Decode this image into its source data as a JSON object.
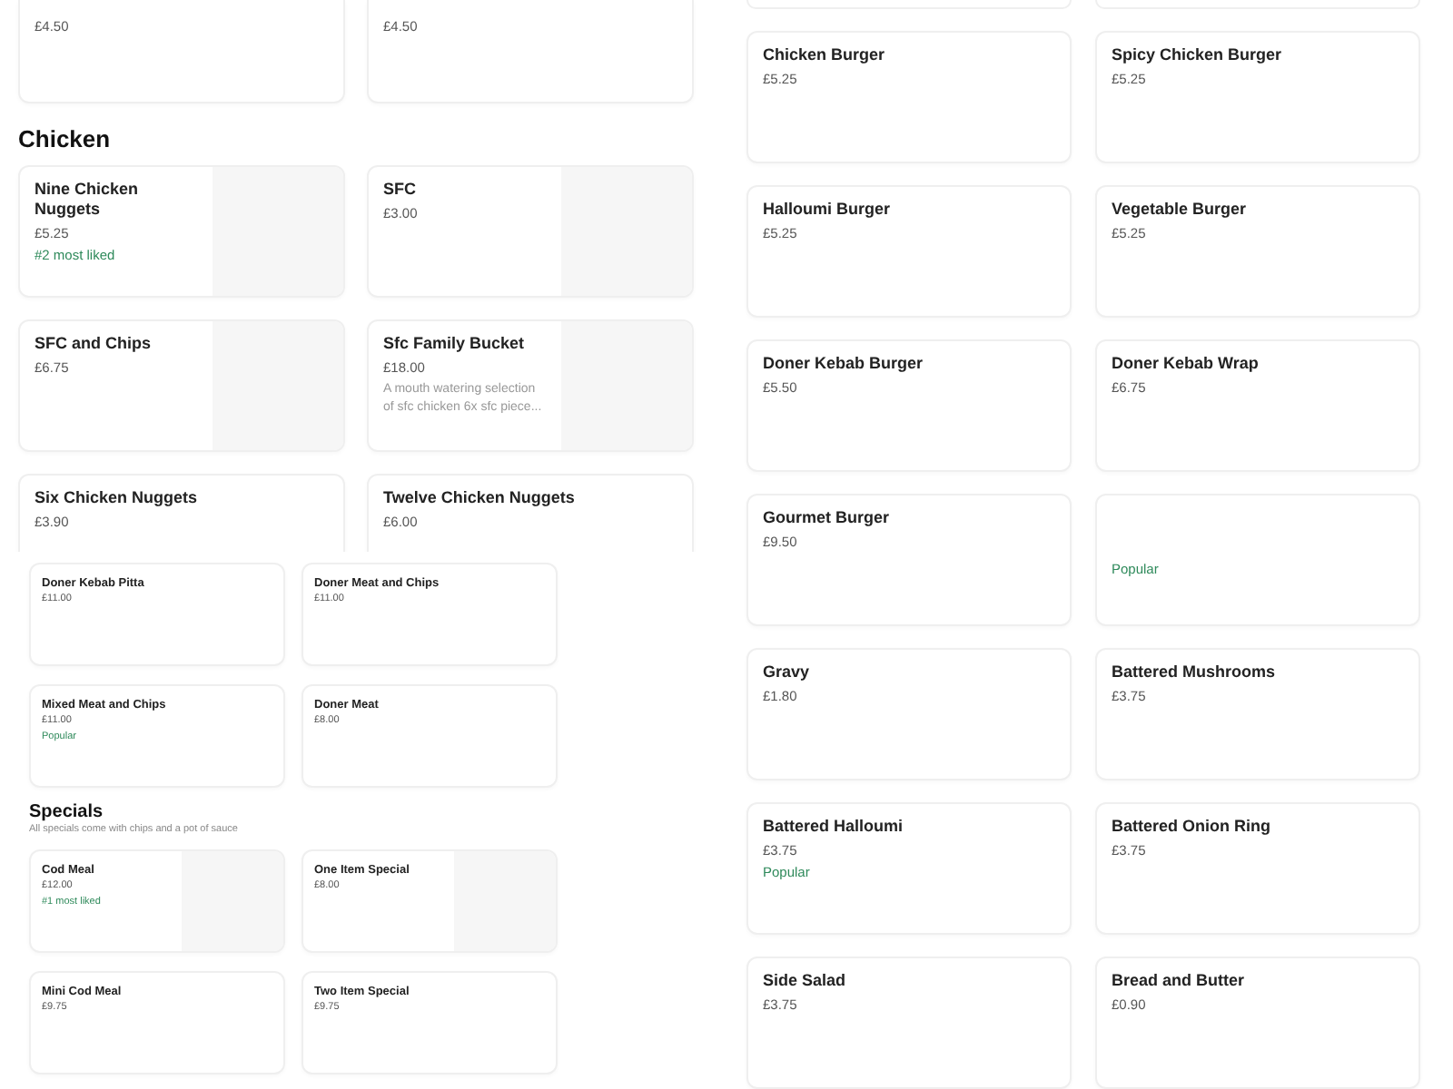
{
  "left_top": {
    "sections": [
      {
        "cards": [
          {
            "price": "£4.50"
          },
          {
            "price": "£4.50"
          }
        ]
      },
      {
        "title": "Chicken",
        "cards": [
          {
            "name": "Nine Chicken Nuggets",
            "price": "£5.25",
            "tag": "#2 most liked",
            "has_image": true
          },
          {
            "name": "SFC",
            "price": "£3.00",
            "has_image": true
          },
          {
            "name": "SFC and Chips",
            "price": "£6.75",
            "has_image": true
          },
          {
            "name": "Sfc Family Bucket",
            "price": "£18.00",
            "description": "A mouth watering selection of sfc chicken 6x sfc piece...",
            "has_image": true
          },
          {
            "name": "Six Chicken Nuggets",
            "price": "£3.90"
          },
          {
            "name": "Twelve Chicken Nuggets",
            "price": "£6.00"
          }
        ]
      }
    ]
  },
  "left_bottom": {
    "sections": [
      {
        "cards": [
          {
            "name": "Doner Kebab Pitta",
            "price": "£11.00"
          },
          {
            "name": "Doner Meat and Chips",
            "price": "£11.00"
          },
          {
            "name": "Mixed Meat and Chips",
            "price": "£11.00",
            "tag": "Popular"
          },
          {
            "name": "Doner Meat",
            "price": "£8.00"
          }
        ]
      },
      {
        "title": "Specials",
        "subtitle": "All specials come with chips and a pot of sauce",
        "cards": [
          {
            "name": "Cod Meal",
            "price": "£12.00",
            "tag": "#1 most liked",
            "has_image": true
          },
          {
            "name": "One Item Special",
            "price": "£8.00",
            "has_image": true
          },
          {
            "name": "Mini Cod Meal",
            "price": "£9.75"
          },
          {
            "name": "Two Item Special",
            "price": "£9.75"
          }
        ]
      }
    ]
  },
  "right": {
    "sections": [
      {
        "cards": [
          {
            "name": "Chicken Burger",
            "price": "£5.25"
          },
          {
            "name": "Spicy Chicken Burger",
            "price": "£5.25"
          },
          {
            "name": "Halloumi Burger",
            "price": "£5.25"
          },
          {
            "name": "Vegetable Burger",
            "price": "£5.25"
          },
          {
            "name": "Doner Kebab Burger",
            "price": "£5.50"
          },
          {
            "name": "Doner Kebab Wrap",
            "price": "£6.75"
          },
          {
            "name": "Gourmet Burger",
            "price": "£9.50"
          },
          {
            "tag": "Popular"
          },
          {
            "name": "Gravy",
            "price": "£1.80"
          },
          {
            "name": "Battered Mushrooms",
            "price": "£3.75"
          },
          {
            "name": "Battered Halloumi",
            "price": "£3.75",
            "tag": "Popular"
          },
          {
            "name": "Battered Onion Ring",
            "price": "£3.75"
          },
          {
            "name": "Side Salad",
            "price": "£3.75"
          },
          {
            "name": "Bread and Butter",
            "price": "£0.90"
          }
        ]
      }
    ]
  }
}
